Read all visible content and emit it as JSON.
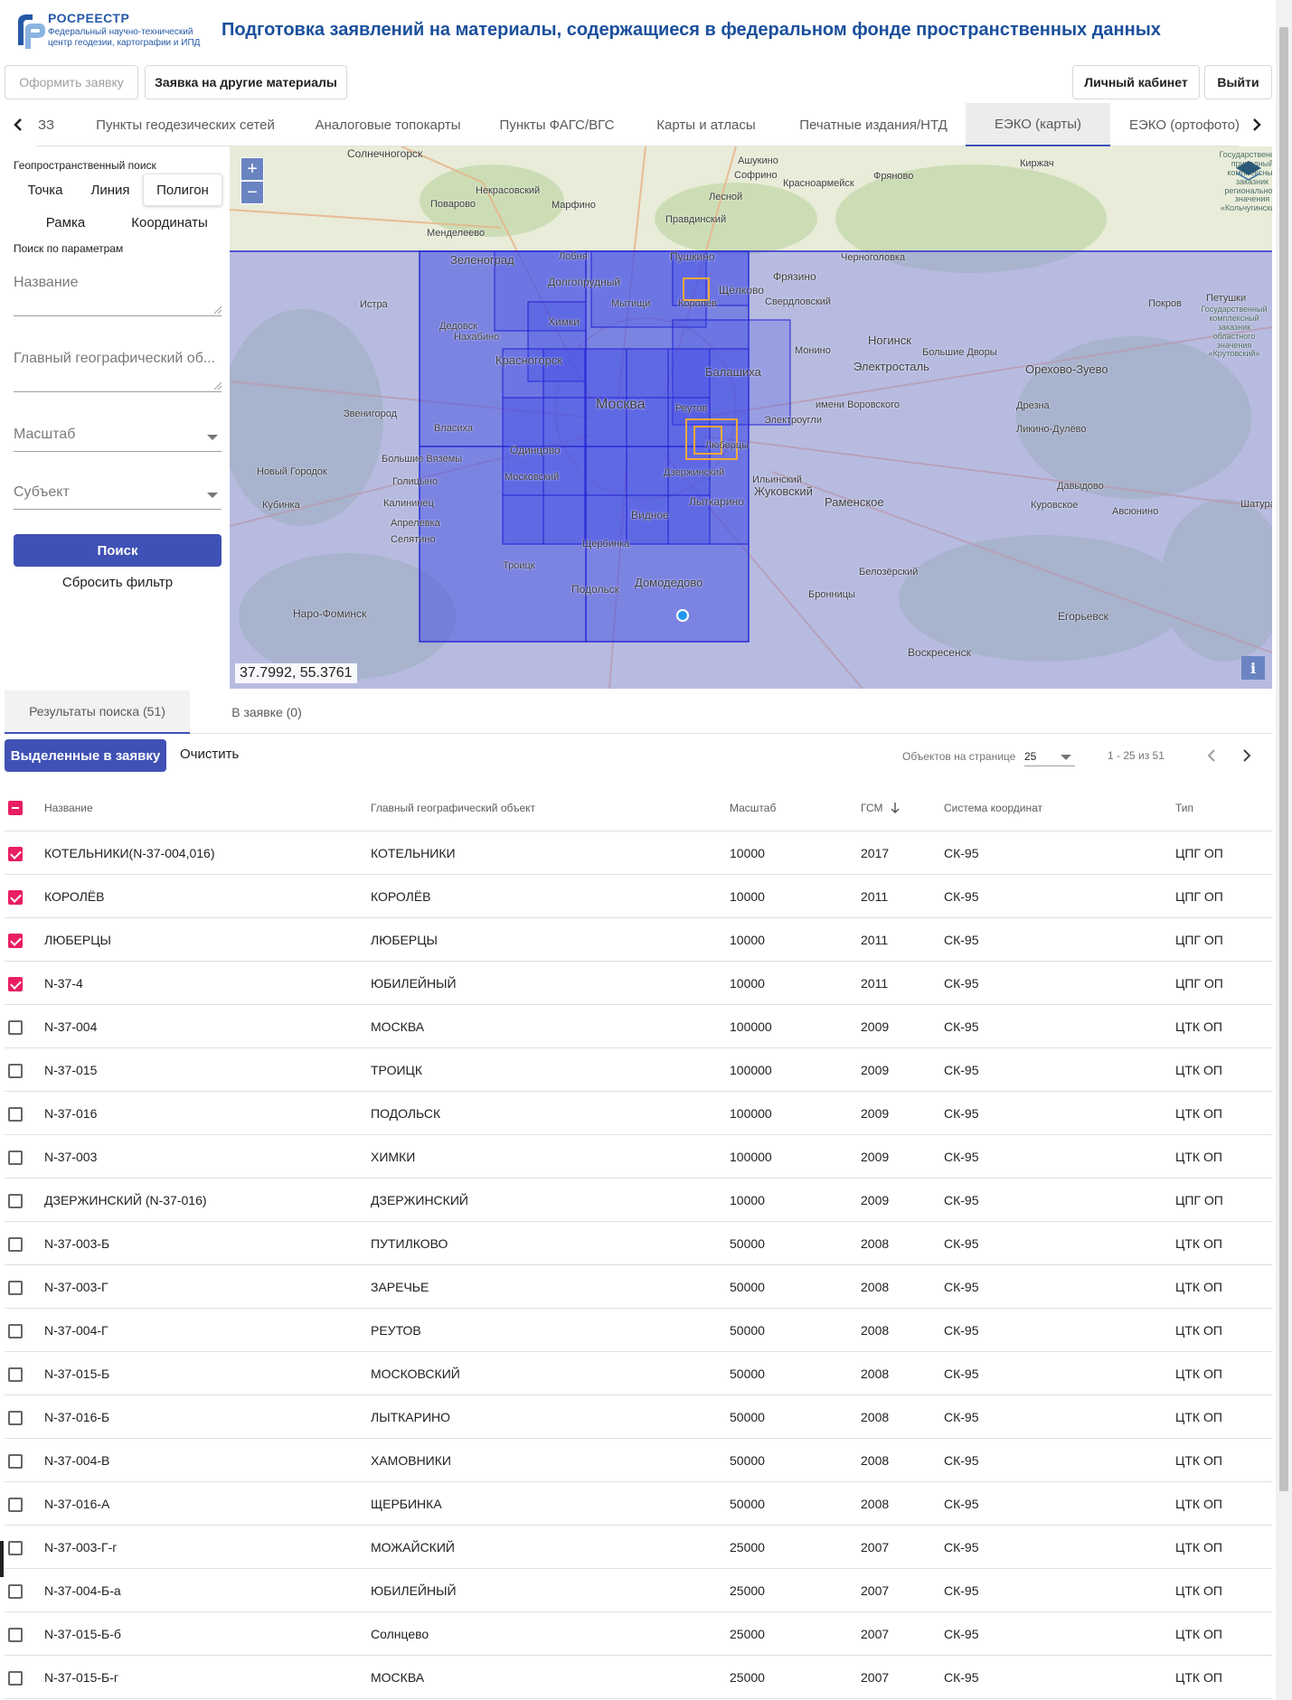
{
  "header": {
    "logo_name": "РОСРЕЕСТР",
    "logo_sub": "Федеральный научно-технический центр геодезии, картографии и ИПД",
    "title": "Подготовка заявлений на материалы, содержащиеся в федеральном фонде пространственных данных"
  },
  "toolbar": {
    "submit_label": "Оформить заявку",
    "other_label": "Заявка на другие материалы",
    "cabinet_label": "Личный кабинет",
    "logout_label": "Выйти"
  },
  "tabs": [
    {
      "label": "ЗЗ"
    },
    {
      "label": "Пункты геодезических сетей"
    },
    {
      "label": "Аналоговые топокарты"
    },
    {
      "label": "Пункты ФАГС/ВГС"
    },
    {
      "label": "Карты и атласы"
    },
    {
      "label": "Печатные издания/НТД"
    },
    {
      "label": "ЕЭКО (карты)",
      "active": true
    },
    {
      "label": "ЕЭКО (ортофото)"
    }
  ],
  "search_panel": {
    "geo_label": "Геопространственный поиск",
    "modes": [
      "Точка",
      "Линия",
      "Полигон",
      "Рамка",
      "Координаты"
    ],
    "active_mode": "Полигон",
    "params_label": "Поиск по параметрам",
    "name_placeholder": "Название",
    "geo_object_placeholder": "Главный географический об...",
    "scale_placeholder": "Масштаб",
    "subject_placeholder": "Субъект",
    "search_label": "Поиск",
    "reset_label": "Сбросить фильтр"
  },
  "map": {
    "coords": "37.7992, 55.3761",
    "zoom_in": "+",
    "zoom_out": "−",
    "info": "i",
    "labels": [
      "Солнечногорск",
      "Ашукино",
      "Софрино",
      "Фряново",
      "Киржач",
      "Некрасовский",
      "Красноармейск",
      "Поварово",
      "Марфино",
      "Лесной",
      "Правдинский",
      "Менделеево",
      "Зеленоград",
      "Лобня",
      "Долгопрудный",
      "Пушкино",
      "Фрязино",
      "Щёлково",
      "Черноголовка",
      "Истра",
      "Химки",
      "Мытищи",
      "Королёв",
      "Свердловский",
      "Петушки",
      "Дедовск",
      "Нахабино",
      "Красногорск",
      "Балашиха",
      "Монино",
      "Ногинск",
      "Электроугли",
      "Электросталь",
      "Большие Дворы",
      "Орехово-Зуево",
      "Покров",
      "Звенигород",
      "Москва",
      "Реутов",
      "имени Воровского",
      "Дрезна",
      "Ликино-Дулёво",
      "Власиха",
      "Одинцово",
      "Люберцы",
      "Большие Вязёмы",
      "Новый Городок",
      "Голицыно",
      "Московский",
      "Дзержинский",
      "Ильинский",
      "Жуковский",
      "Раменское",
      "Давыдово",
      "Куровское",
      "Авсюнино",
      "Кубинка",
      "Калининец",
      "Видное",
      "Лыткарино",
      "Шатура",
      "Апрелевка",
      "Селятино",
      "Щербинка",
      "Троицк",
      "Белозёрский",
      "Подольск",
      "Домодедово",
      "Бронницы",
      "Наро-Фоминск",
      "Егорьевск",
      "Воскресенск",
      "Государственный комплексный заказник областного значения «Крутовский»",
      "Государственный природный комплексный заказник регионального значения «Кольчугинский»"
    ]
  },
  "results": {
    "tab_results": "Результаты поиска (51)",
    "tab_request": "В заявке (0)",
    "add_label": "Выделенные в заявку",
    "clear_label": "Очистить",
    "per_page_label": "Объектов на странице",
    "per_page_value": "25",
    "range": "1 - 25 из 51",
    "columns": [
      "Название",
      "Главный географический объект",
      "Масштаб",
      "ГСМ",
      "Система координат",
      "Тип"
    ],
    "rows": [
      {
        "checked": true,
        "name": "КОТЕЛЬНИКИ(N-37-004,016)",
        "geo": "КОТЕЛЬНИКИ",
        "scale": "10000",
        "gsm": "2017",
        "crs": "СК-95",
        "type": "ЦПГ ОП"
      },
      {
        "checked": true,
        "name": "КОРОЛЁВ",
        "geo": "КОРОЛЁВ",
        "scale": "10000",
        "gsm": "2011",
        "crs": "СК-95",
        "type": "ЦПГ ОП"
      },
      {
        "checked": true,
        "name": "ЛЮБЕРЦЫ",
        "geo": "ЛЮБЕРЦЫ",
        "scale": "10000",
        "gsm": "2011",
        "crs": "СК-95",
        "type": "ЦПГ ОП"
      },
      {
        "checked": true,
        "name": "N-37-4",
        "geo": "ЮБИЛЕЙНЫЙ",
        "scale": "10000",
        "gsm": "2011",
        "crs": "СК-95",
        "type": "ЦПГ ОП"
      },
      {
        "checked": false,
        "name": "N-37-004",
        "geo": "МОСКВА",
        "scale": "100000",
        "gsm": "2009",
        "crs": "СК-95",
        "type": "ЦТК ОП"
      },
      {
        "checked": false,
        "name": "N-37-015",
        "geo": "ТРОИЦК",
        "scale": "100000",
        "gsm": "2009",
        "crs": "СК-95",
        "type": "ЦТК ОП"
      },
      {
        "checked": false,
        "name": "N-37-016",
        "geo": "ПОДОЛЬСК",
        "scale": "100000",
        "gsm": "2009",
        "crs": "СК-95",
        "type": "ЦТК ОП"
      },
      {
        "checked": false,
        "name": "N-37-003",
        "geo": "ХИМКИ",
        "scale": "100000",
        "gsm": "2009",
        "crs": "СК-95",
        "type": "ЦТК ОП"
      },
      {
        "checked": false,
        "name": "ДЗЕРЖИНСКИЙ (N-37-016)",
        "geo": "ДЗЕРЖИНСКИЙ",
        "scale": "10000",
        "gsm": "2009",
        "crs": "СК-95",
        "type": "ЦПГ ОП"
      },
      {
        "checked": false,
        "name": "N-37-003-Б",
        "geo": "ПУТИЛКОВО",
        "scale": "50000",
        "gsm": "2008",
        "crs": "СК-95",
        "type": "ЦТК ОП"
      },
      {
        "checked": false,
        "name": "N-37-003-Г",
        "geo": "ЗАРЕЧЬЕ",
        "scale": "50000",
        "gsm": "2008",
        "crs": "СК-95",
        "type": "ЦТК ОП"
      },
      {
        "checked": false,
        "name": "N-37-004-Г",
        "geo": "РЕУТОВ",
        "scale": "50000",
        "gsm": "2008",
        "crs": "СК-95",
        "type": "ЦТК ОП"
      },
      {
        "checked": false,
        "name": "N-37-015-Б",
        "geo": "МОСКОВСКИЙ",
        "scale": "50000",
        "gsm": "2008",
        "crs": "СК-95",
        "type": "ЦТК ОП"
      },
      {
        "checked": false,
        "name": "N-37-016-Б",
        "geo": "ЛЫТКАРИНО",
        "scale": "50000",
        "gsm": "2008",
        "crs": "СК-95",
        "type": "ЦТК ОП"
      },
      {
        "checked": false,
        "name": "N-37-004-В",
        "geo": "ХАМОВНИКИ",
        "scale": "50000",
        "gsm": "2008",
        "crs": "СК-95",
        "type": "ЦТК ОП"
      },
      {
        "checked": false,
        "name": "N-37-016-А",
        "geo": "ЩЕРБИНКА",
        "scale": "50000",
        "gsm": "2008",
        "crs": "СК-95",
        "type": "ЦТК ОП"
      },
      {
        "checked": false,
        "name": "N-37-003-Г-г",
        "geo": "МОЖАЙСКИЙ",
        "scale": "25000",
        "gsm": "2007",
        "crs": "СК-95",
        "type": "ЦТК ОП"
      },
      {
        "checked": false,
        "name": "N-37-004-Б-а",
        "geo": "ЮБИЛЕЙНЫЙ",
        "scale": "25000",
        "gsm": "2007",
        "crs": "СК-95",
        "type": "ЦТК ОП"
      },
      {
        "checked": false,
        "name": "N-37-015-Б-б",
        "geo": "Солнцево",
        "scale": "25000",
        "gsm": "2007",
        "crs": "СК-95",
        "type": "ЦТК ОП"
      },
      {
        "checked": false,
        "name": "N-37-015-Б-г",
        "geo": "МОСКВА",
        "scale": "25000",
        "gsm": "2007",
        "crs": "СК-95",
        "type": "ЦТК ОП"
      }
    ]
  },
  "colors": {
    "accent": "#3f51b5",
    "checkbox": "#e91e63",
    "brand": "#2659a6",
    "overlay": "#3c48e6"
  }
}
